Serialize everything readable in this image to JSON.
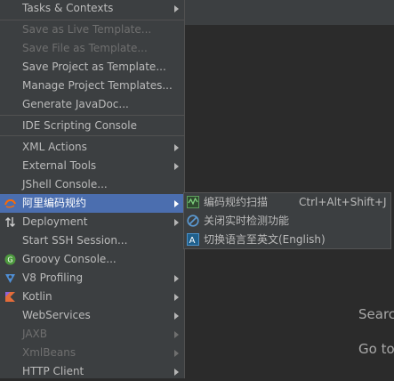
{
  "menu": {
    "tasks_contexts": "Tasks & Contexts",
    "save_live_template": "Save as Live Template...",
    "save_file_template": "Save File as Template...",
    "save_project_template": "Save Project as Template...",
    "manage_project_templates": "Manage Project Templates...",
    "generate_javadoc": "Generate JavaDoc...",
    "ide_scripting_console": "IDE Scripting Console",
    "xml_actions": "XML Actions",
    "external_tools": "External Tools",
    "jshell_console": "JShell Console...",
    "alibaba_coding": "阿里编码规约",
    "deployment": "Deployment",
    "start_ssh": "Start SSH Session...",
    "groovy_console": "Groovy Console...",
    "v8_profiling": "V8 Profiling",
    "kotlin": "Kotlin",
    "webservices": "WebServices",
    "jaxb": "JAXB",
    "xmlbeans": "XmlBeans",
    "http_client": "HTTP Client"
  },
  "submenu": {
    "scan": "编码规约扫描",
    "scan_shortcut": "Ctrl+Alt+Shift+J",
    "close_realtime": "关闭实时检测功能",
    "switch_language": "切换语言至英文(English)"
  },
  "editor": {
    "hint_search": "Searc",
    "hint_goto": "Go to"
  },
  "colors": {
    "menu_bg": "#3c3f41",
    "selection": "#4b6eaf",
    "editor_bg": "#2b2b2b",
    "disabled_text": "#6f6f6f"
  }
}
